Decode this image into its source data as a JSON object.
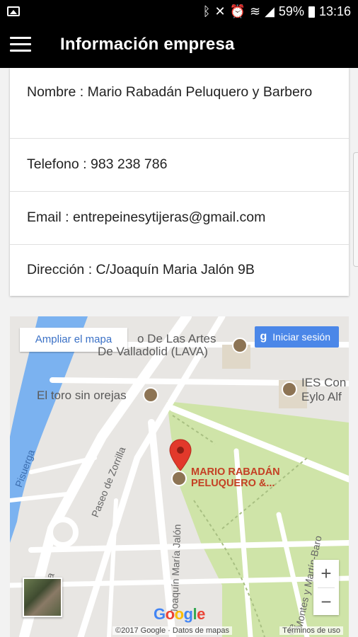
{
  "status_bar": {
    "battery": "59%",
    "time": "13:16",
    "icons": [
      "gallery-icon",
      "bluetooth-icon",
      "mute-icon",
      "alarm-icon",
      "wifi-icon",
      "signal-icon",
      "battery-icon"
    ]
  },
  "app_bar": {
    "title": "Información empresa"
  },
  "info": {
    "nombre": "Nombre : Mario Rabadán Peluquero y Barbero",
    "telefono": "Telefono : 983 238 786",
    "email": "Email : entrepeinesytijeras@gmail.com",
    "direccion": "Dirección : C/Joaquín Maria Jalón 9B"
  },
  "map": {
    "enlarge_label": "Ampliar el mapa",
    "signin_label": "Iniciar sesión",
    "labels": {
      "lava_line1": "o De Las Artes",
      "lava_line2": "De Valladolid (LAVA)",
      "toro": "El toro sin orejas",
      "ies_line1": "IES Con",
      "ies_line2": "Eylo Alf",
      "pisuerga": "Pisuerga",
      "paseo": "Paseo de Zorrilla",
      "zorrilla": "Zorrilla",
      "joaquin": "Joaquín María Jalón",
      "montes": "Montes y Martín-Baro",
      "de": "de"
    },
    "business_line1": "MARIO RABADÁN",
    "business_line2": "PELUQUERO &...",
    "zoom_in": "+",
    "zoom_out": "−",
    "google": "Google",
    "copyright": "©2017 Google · Datos de mapas",
    "terms": "Términos de uso",
    "colors": {
      "water": "#7bb2f0",
      "park": "#cfe4a8",
      "road": "#ffffff",
      "marker": "#e2392b",
      "accent": "#4b87e8"
    }
  }
}
